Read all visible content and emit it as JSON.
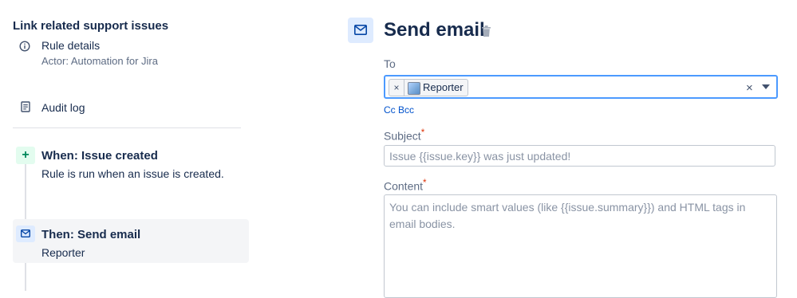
{
  "sidebar": {
    "rule_name": "Link related support issues",
    "details": {
      "label": "Rule details",
      "actor": "Actor: Automation for Jira",
      "icon": "info-icon"
    },
    "audit": {
      "label": "Audit log",
      "icon": "document-icon"
    },
    "trigger": {
      "title": "When: Issue created",
      "description": "Rule is run when an issue is created.",
      "icon": "plus-icon",
      "icon_glyph": "+",
      "accent": "#00875a"
    },
    "action": {
      "title": "Then: Send email",
      "description": "Reporter",
      "icon": "mail-icon",
      "accent": "#0052cc"
    }
  },
  "panel": {
    "title": "Send email",
    "title_icon": "mail-icon",
    "delete_icon": "trash-icon",
    "to": {
      "label": "To",
      "chips": [
        {
          "label": "Reporter",
          "remove_glyph": "×"
        }
      ],
      "clear_glyph": "×"
    },
    "cc_bcc": "Cc Bcc",
    "subject": {
      "label": "Subject",
      "required_mark": "*",
      "placeholder": "Issue {{issue.key}} was just updated!"
    },
    "content": {
      "label": "Content",
      "required_mark": "*",
      "placeholder": "You can include smart values (like {{issue.summary}}) and HTML tags in email bodies."
    }
  },
  "colors": {
    "focus_border": "#4c9aff",
    "required": "#de350b",
    "link": "#0052cc",
    "selected_card": "#f4f5f7"
  }
}
